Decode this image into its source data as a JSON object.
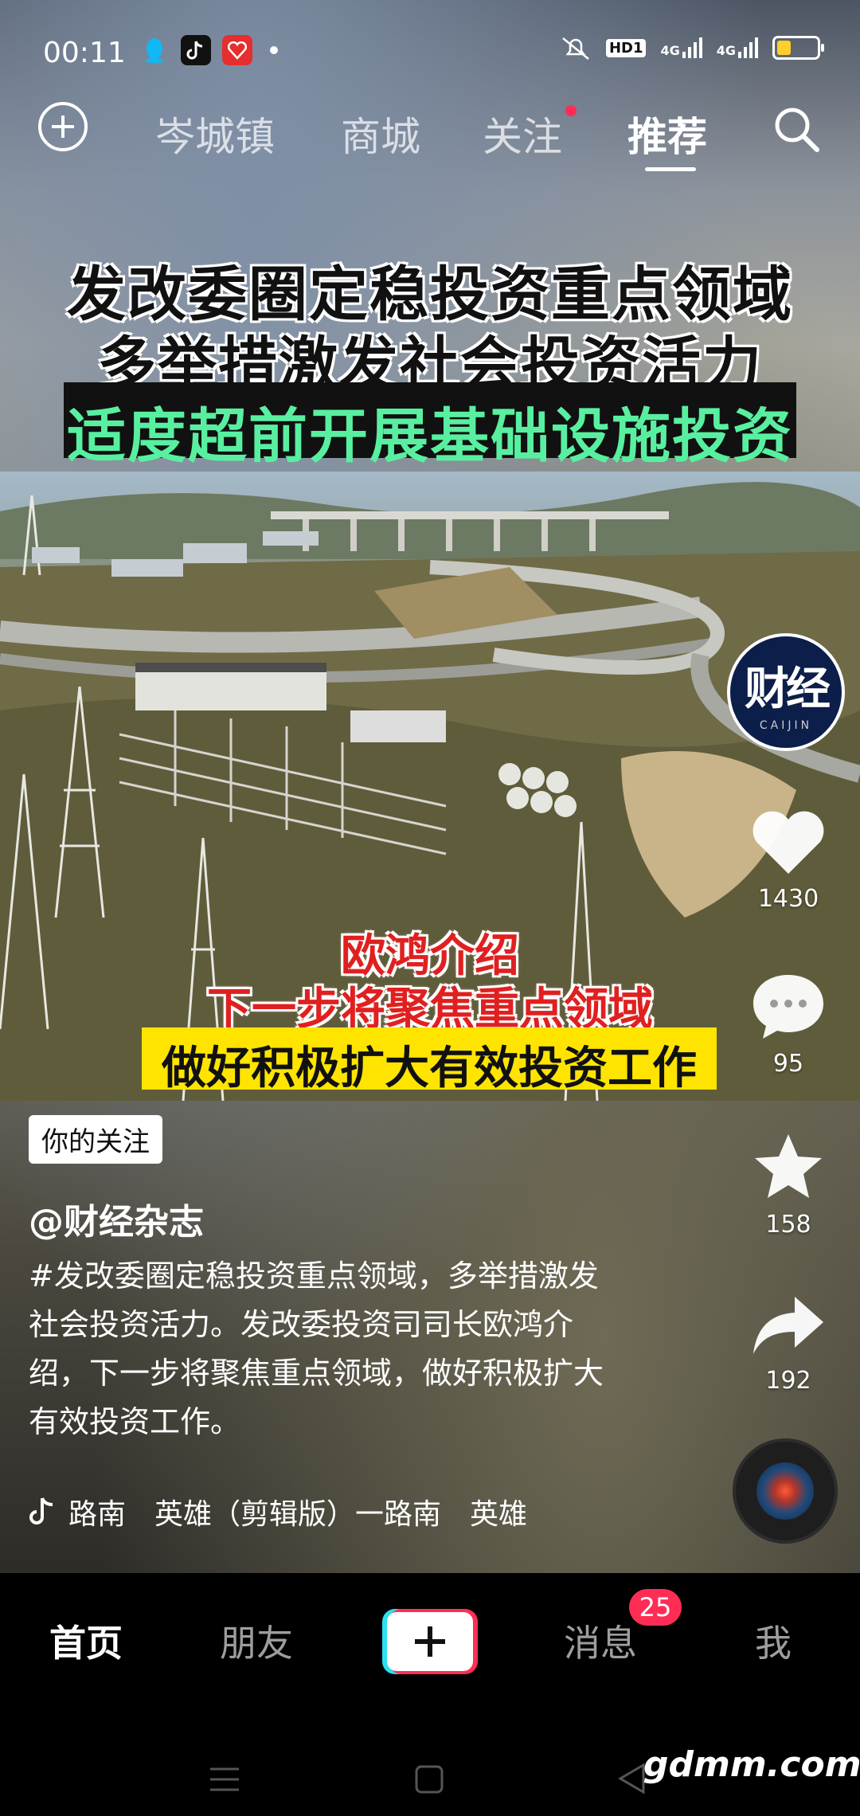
{
  "status_bar": {
    "time": "00:11",
    "network_1": "4G",
    "network_2": "4G",
    "hd_label": "HD1",
    "battery_level": 0.35
  },
  "top_nav": {
    "tabs": [
      {
        "label": "岑城镇",
        "active": false
      },
      {
        "label": "商城",
        "active": false
      },
      {
        "label": "关注",
        "active": false,
        "has_dot": true
      },
      {
        "label": "推荐",
        "active": true
      }
    ]
  },
  "video": {
    "headline_1": "发改委圈定稳投资重点领域",
    "headline_2": "多举措激发社会投资活力",
    "headline_3": "适度超前开展基础设施投资",
    "caption_1": "欧鸿介绍",
    "caption_2": "下一步将聚焦重点领域",
    "caption_3": "做好积极扩大有效投资工作"
  },
  "creator": {
    "avatar_text": "财经",
    "avatar_subtext": "CAIJIN"
  },
  "actions": {
    "likes": "1430",
    "comments": "95",
    "favorites": "158",
    "shares": "192"
  },
  "info": {
    "follow_tag": "你的关注",
    "author": "@财经杂志",
    "description": "#发改委圈定稳投资重点领域，多举措激发社会投资活力。发改委投资司司长欧鸿介绍，下一步将聚焦重点领域，做好积极扩大有效投资工作。",
    "music": "路南　英雄（剪辑版）一路南　英雄"
  },
  "bottom_nav": {
    "home": "首页",
    "friends": "朋友",
    "messages": "消息",
    "messages_badge": "25",
    "me": "我"
  },
  "watermark": "gdmm.com",
  "colors": {
    "accent_red": "#ff2d55",
    "accent_cyan": "#2de0f0",
    "headline_green": "#58f0a0",
    "caption_red": "#e02020",
    "caption_yellow": "#ffe400"
  }
}
